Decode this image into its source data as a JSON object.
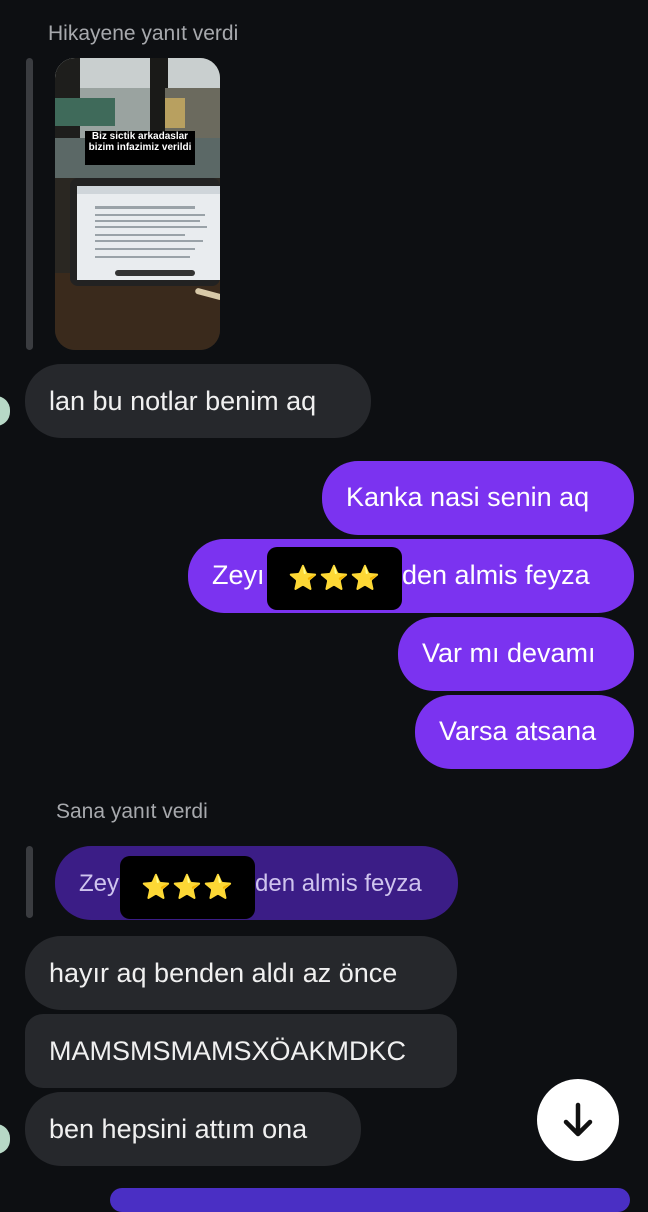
{
  "thread": {
    "story_reply_label": "Hikayene yanıt verdi",
    "story_caption": "Biz sictik arkadaslar bizim infazimiz verildi",
    "messages": {
      "m1": "lan bu notlar benim aq",
      "m2": "Kanka nasi senin aq",
      "m3_left": "Zeyı",
      "m3_stars": "⭐⭐⭐",
      "m3_right": "den almis feyza",
      "m4": "Var mı devamı",
      "m5": "Varsa atsana",
      "reply_label": "Sana yanıt verdi",
      "quote_left": "Zey",
      "quote_stars": "⭐⭐⭐",
      "quote_right": "den almis feyza",
      "m6": "hayır aq benden aldı az önce",
      "m7": "MAMSMSMAMSXÖAKMDKC",
      "m8": "ben hepsini attım ona"
    }
  },
  "icons": {
    "scroll_down": "arrow-down-icon"
  },
  "colors": {
    "outgoing": "#7b33f0",
    "incoming": "#26282c",
    "quoted": "#3b1d86",
    "background": "#0d0f12"
  }
}
